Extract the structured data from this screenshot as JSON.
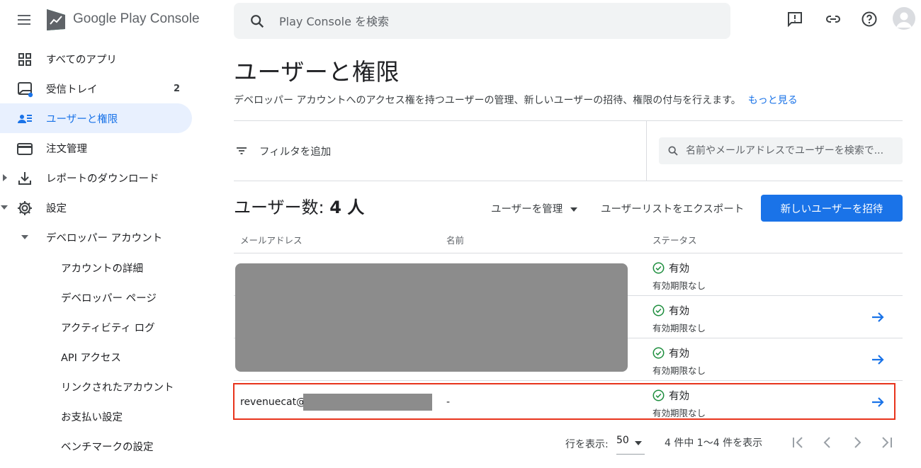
{
  "app": {
    "brand_prefix": "Google Play",
    "brand_suffix": " Console"
  },
  "search": {
    "placeholder": "Play Console を検索"
  },
  "sidebar": {
    "items": [
      {
        "label": "すべてのアプリ"
      },
      {
        "label": "受信トレイ",
        "badge": "2"
      },
      {
        "label": "ユーザーと権限"
      },
      {
        "label": "注文管理"
      },
      {
        "label": "レポートのダウンロード"
      },
      {
        "label": "設定"
      },
      {
        "label": "デベロッパー アカウント"
      }
    ],
    "sub_items": [
      {
        "label": "アカウントの詳細"
      },
      {
        "label": "デベロッパー ページ"
      },
      {
        "label": "アクティビティ ログ"
      },
      {
        "label": "API アクセス"
      },
      {
        "label": "リンクされたアカウント"
      },
      {
        "label": "お支払い設定"
      },
      {
        "label": "ベンチマークの設定"
      }
    ]
  },
  "main": {
    "title": "ユーザーと権限",
    "description": "デベロッパー アカウントへのアクセス権を持つユーザーの管理、新しいユーザーの招待、権限の付与を行えます。",
    "more_link": "もっと見る",
    "filter_label": "フィルタを追加",
    "user_search_placeholder": "名前やメールアドレスでユーザーを検索で...",
    "count_prefix": "ユーザー数:",
    "count_value": "4 人",
    "manage_users": "ユーザーを管理",
    "export_users": "ユーザーリストをエクスポート",
    "invite_button": "新しいユーザーを招待",
    "table": {
      "columns": [
        "メールアドレス",
        "名前",
        "ステータス"
      ],
      "rows": [
        {
          "status": "有効",
          "expiry": "有効期限なし"
        },
        {
          "status": "有効",
          "expiry": "有効期限なし"
        },
        {
          "status": "有効",
          "expiry": "有効期限なし"
        },
        {
          "email": "revenuecat@",
          "name": "-",
          "status": "有効",
          "expiry": "有効期限なし"
        }
      ]
    },
    "pagination": {
      "rows_label": "行を表示:",
      "rows_value": "50",
      "range": "4 件中 1〜4 件を表示"
    }
  },
  "colors": {
    "accent": "#1a73e8",
    "active_bg": "#e8f0fe",
    "highlight_border": "#e8341c",
    "status_green": "#1e8e3e",
    "redaction": "#8c8c8c"
  },
  "icons": [
    "menu-icon",
    "play-console-logo",
    "search-icon",
    "feedback-icon",
    "link-icon",
    "help-icon",
    "account-avatar",
    "apps-grid-icon",
    "inbox-icon",
    "users-icon",
    "orders-icon",
    "download-icon",
    "settings-icon",
    "filter-icon",
    "check-circle-icon",
    "arrow-right-icon",
    "first-page-icon",
    "prev-page-icon",
    "next-page-icon",
    "last-page-icon"
  ]
}
